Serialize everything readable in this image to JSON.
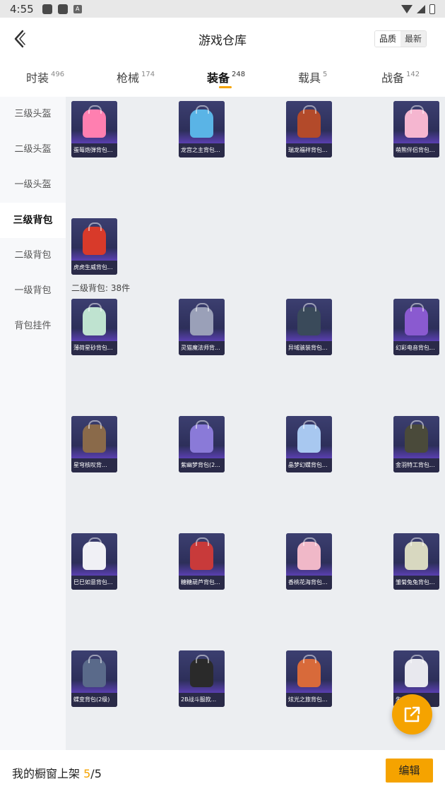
{
  "status_bar": {
    "time": "4:55",
    "a_icon_label": "A"
  },
  "header": {
    "title": "游戏仓库",
    "sort_quality": "品质",
    "sort_newest": "最新"
  },
  "tabs": [
    {
      "label": "时装",
      "count": "496"
    },
    {
      "label": "枪械",
      "count": "174"
    },
    {
      "label": "装备",
      "count": "248",
      "active": true
    },
    {
      "label": "载具",
      "count": "5"
    },
    {
      "label": "战备",
      "count": "142"
    }
  ],
  "sidebar": {
    "items": [
      {
        "label": "三级头盔"
      },
      {
        "label": "二级头盔"
      },
      {
        "label": "一级头盔"
      },
      {
        "label": "三级背包",
        "active": true
      },
      {
        "label": "二级背包"
      },
      {
        "label": "一级背包"
      },
      {
        "label": "背包挂件"
      }
    ]
  },
  "section_lv3": {
    "items": [
      {
        "name": "蛋莓炮弹背包...",
        "color": "#ff7fb0"
      },
      {
        "name": "龙宫之主背包...",
        "color": "#5ab4e6"
      },
      {
        "name": "瑞龙福祥背包...",
        "color": "#b34a2a"
      },
      {
        "name": "萌熊伴侣背包...",
        "color": "#f5b6d0"
      },
      {
        "name": "虎虎生威背包...",
        "color": "#d83a2a"
      }
    ]
  },
  "section_lv2": {
    "label": "二级背包: 38件",
    "items": [
      {
        "name": "薄荷星砂背包...",
        "color": "#bfe3d0"
      },
      {
        "name": "灵猫魔法师背...",
        "color": "#9aa0b8"
      },
      {
        "name": "异域骇装背包...",
        "color": "#3a4a5a"
      },
      {
        "name": "幻彩电音背包...",
        "color": "#8a5ad0"
      },
      {
        "name": "星穹核叹背...",
        "color": "#8a6a4a"
      },
      {
        "name": "紫幽梦背包(2...",
        "color": "#8a7ad8"
      },
      {
        "name": "晶梦幻蝶背包...",
        "color": "#a8c8f0"
      },
      {
        "name": "金羽特工背包...",
        "color": "#4a4a3a"
      },
      {
        "name": "巳巳如意背包...",
        "color": "#f0f0f5"
      },
      {
        "name": "糖糖葫芦背包...",
        "color": "#c83a3a"
      },
      {
        "name": "香桃花海背包...",
        "color": "#f0b8c8"
      },
      {
        "name": "雏菊兔兔背包...",
        "color": "#d8d8c0"
      },
      {
        "name": "蝶变背包(2级)",
        "color": "#5a6a8a"
      },
      {
        "name": "2B战斗服款...",
        "color": "#2a2a2a"
      },
      {
        "name": "炫光之旅背包...",
        "color": "#d86a3a"
      },
      {
        "name": "朱...",
        "color": "#e8e8ee"
      }
    ]
  },
  "bottom_bar": {
    "label": "我的橱窗上架",
    "count": "5",
    "separator": "/",
    "total": "5",
    "edit_label": "编辑"
  },
  "colors": {
    "accent": "#f5a300"
  }
}
